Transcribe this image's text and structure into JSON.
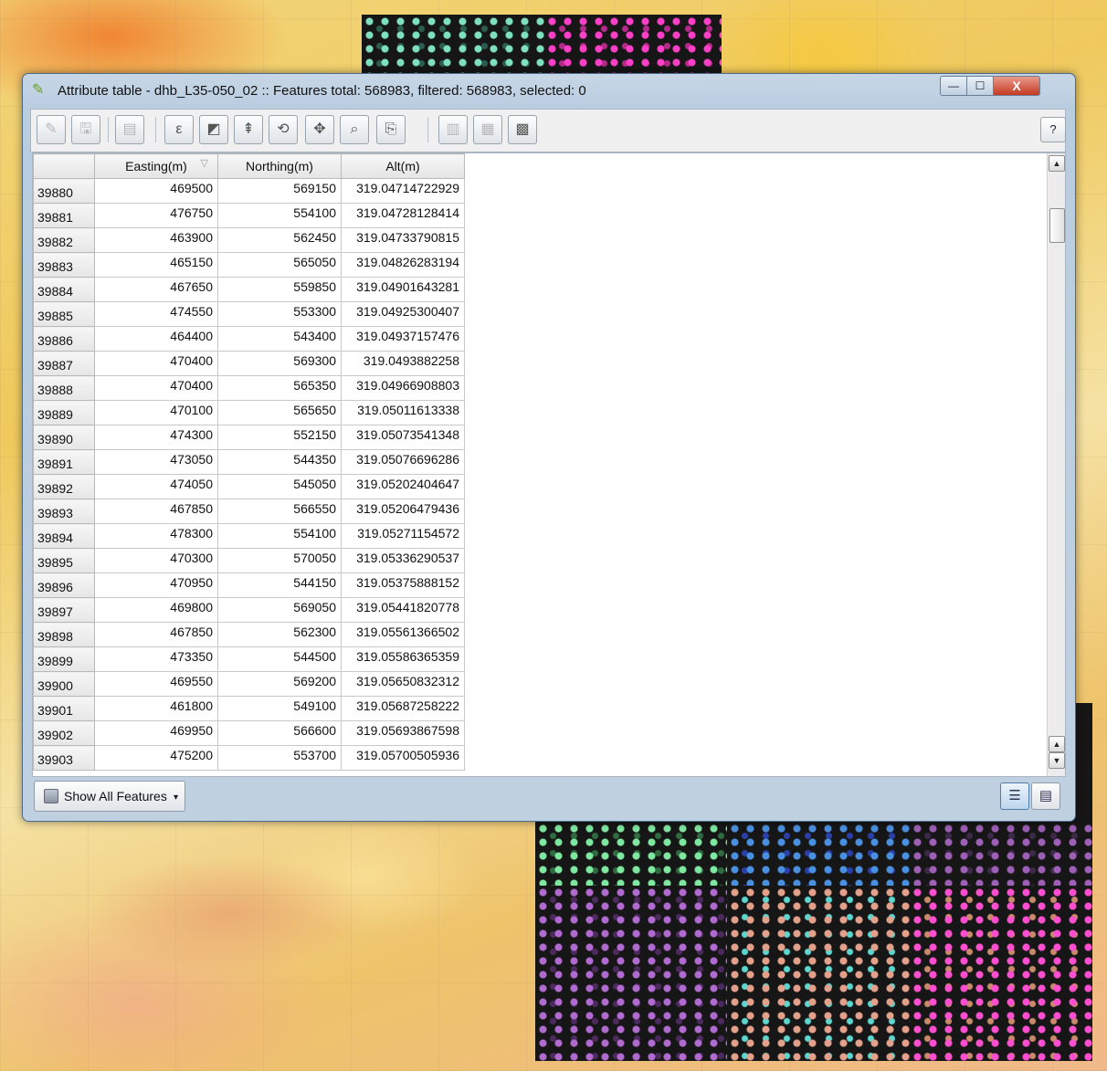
{
  "window": {
    "title": "Attribute table - dhb_L35-050_02 :: Features total: 568983, filtered: 568983, selected: 0",
    "min_glyph": "—",
    "max_glyph": "☐",
    "close_glyph": "X"
  },
  "toolbar": {
    "help_label": "?",
    "buttons": [
      {
        "icon": "pencil-icon",
        "glyph": "✎"
      },
      {
        "icon": "save-icon",
        "glyph": "🖫"
      },
      {
        "icon": "delete-selected-icon",
        "glyph": "▤"
      },
      {
        "icon": "expression-select-icon",
        "glyph": "ε"
      },
      {
        "icon": "deselect-icon",
        "glyph": "◩"
      },
      {
        "icon": "move-selection-top-icon",
        "glyph": "⇞"
      },
      {
        "icon": "invert-selection-icon",
        "glyph": "⟲"
      },
      {
        "icon": "pan-to-selected-icon",
        "glyph": "✥"
      },
      {
        "icon": "zoom-to-selected-icon",
        "glyph": "⌕"
      },
      {
        "icon": "copy-rows-icon",
        "glyph": "⎘"
      },
      {
        "icon": "new-column-icon",
        "glyph": "▥"
      },
      {
        "icon": "delete-column-icon",
        "glyph": "▦"
      },
      {
        "icon": "field-calculator-icon",
        "glyph": "▩"
      }
    ]
  },
  "table": {
    "columns": [
      "",
      "Easting(m)",
      "Northing(m)",
      "Alt(m)"
    ],
    "rows": [
      [
        "39880",
        "469500",
        "569150",
        "319.04714722929"
      ],
      [
        "39881",
        "476750",
        "554100",
        "319.04728128414"
      ],
      [
        "39882",
        "463900",
        "562450",
        "319.04733790815"
      ],
      [
        "39883",
        "465150",
        "565050",
        "319.04826283194"
      ],
      [
        "39884",
        "467650",
        "559850",
        "319.04901643281"
      ],
      [
        "39885",
        "474550",
        "553300",
        "319.04925300407"
      ],
      [
        "39886",
        "464400",
        "543400",
        "319.04937157476"
      ],
      [
        "39887",
        "470400",
        "569300",
        "319.0493882258"
      ],
      [
        "39888",
        "470400",
        "565350",
        "319.04966908803"
      ],
      [
        "39889",
        "470100",
        "565650",
        "319.05011613338"
      ],
      [
        "39890",
        "474300",
        "552150",
        "319.05073541348"
      ],
      [
        "39891",
        "473050",
        "544350",
        "319.05076696286"
      ],
      [
        "39892",
        "474050",
        "545050",
        "319.05202404647"
      ],
      [
        "39893",
        "467850",
        "566550",
        "319.05206479436"
      ],
      [
        "39894",
        "478300",
        "554100",
        "319.05271154572"
      ],
      [
        "39895",
        "470300",
        "570050",
        "319.05336290537"
      ],
      [
        "39896",
        "470950",
        "544150",
        "319.05375888152"
      ],
      [
        "39897",
        "469800",
        "569050",
        "319.05441820778"
      ],
      [
        "39898",
        "467850",
        "562300",
        "319.05561366502"
      ],
      [
        "39899",
        "473350",
        "544500",
        "319.05586365359"
      ],
      [
        "39900",
        "469550",
        "569200",
        "319.05650832312"
      ],
      [
        "39901",
        "461800",
        "549100",
        "319.05687258222"
      ],
      [
        "39902",
        "469950",
        "566600",
        "319.05693867598"
      ],
      [
        "39903",
        "475200",
        "553700",
        "319.05700505936"
      ]
    ]
  },
  "footer": {
    "filter_label": "Show All Features"
  },
  "colors": {
    "accent": "#4f7ea8",
    "map_tile_mint": "#7fe0c0",
    "map_tile_magenta": "#ff3fc8",
    "map_tile_blue": "#4a90e0",
    "map_tile_purple": "#b06ad0",
    "map_tile_salmon": "#e3a08a"
  }
}
